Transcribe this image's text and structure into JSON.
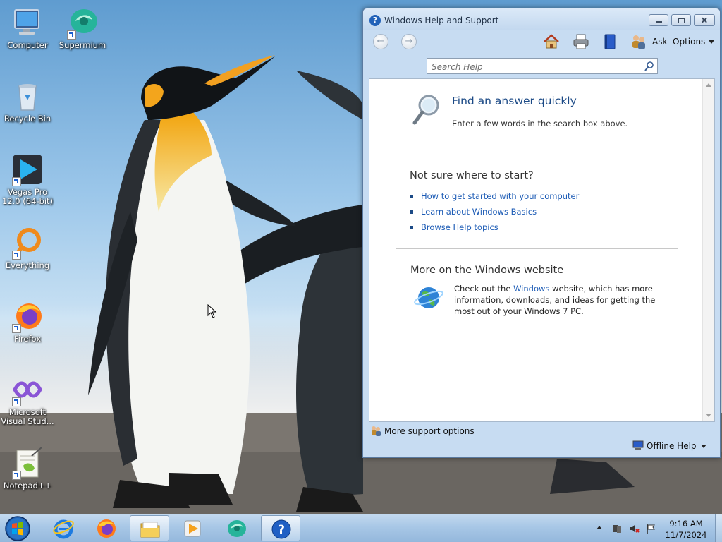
{
  "desktop": {
    "icons": [
      {
        "label": "Computer",
        "icon": "computer-icon"
      },
      {
        "label": "Supermium",
        "icon": "supermium-icon"
      },
      {
        "label": "Recycle Bin",
        "icon": "recycle-bin-icon"
      },
      {
        "label": "Vegas Pro 12.0 (64-bit)",
        "icon": "vegas-pro-icon"
      },
      {
        "label": "Everything",
        "icon": "everything-icon"
      },
      {
        "label": "Firefox",
        "icon": "firefox-icon"
      },
      {
        "label": "Microsoft Visual Stud...",
        "icon": "visual-studio-icon"
      },
      {
        "label": "Notepad++",
        "icon": "notepad-plus-plus-icon"
      }
    ]
  },
  "help_window": {
    "title": "Windows Help and Support",
    "toolbar": {
      "ask_label": "Ask",
      "options_label": "Options"
    },
    "search": {
      "placeholder": "Search Help"
    },
    "content": {
      "find_title": "Find an answer quickly",
      "find_text": "Enter a few words in the search box above.",
      "not_sure_title": "Not sure where to start?",
      "links": [
        "How to get started with your computer",
        "Learn about Windows Basics",
        "Browse Help topics"
      ],
      "more_title": "More on the Windows website",
      "more_text_before": "Check out the ",
      "more_text_link": "Windows",
      "more_text_after": " website, which has more information, downloads, and ideas for getting the most out of your Windows 7 PC."
    },
    "footer": {
      "support_label": "More support options",
      "offline_label": "Offline Help"
    }
  },
  "taskbar": {
    "apps": [
      {
        "name": "internet-explorer",
        "icon": "internet-explorer-icon"
      },
      {
        "name": "firefox",
        "icon": "firefox-icon"
      },
      {
        "name": "file-explorer",
        "icon": "folder-icon"
      },
      {
        "name": "media-player",
        "icon": "media-player-icon"
      },
      {
        "name": "supermium",
        "icon": "supermium-icon"
      },
      {
        "name": "help-and-support",
        "icon": "help-icon"
      }
    ],
    "clock": {
      "time": "9:16 AM",
      "date": "11/7/2024"
    }
  },
  "colors": {
    "link": "#1c5bb5",
    "heading_blue": "#1c4a86",
    "taskbar": "#a8c7e6"
  }
}
